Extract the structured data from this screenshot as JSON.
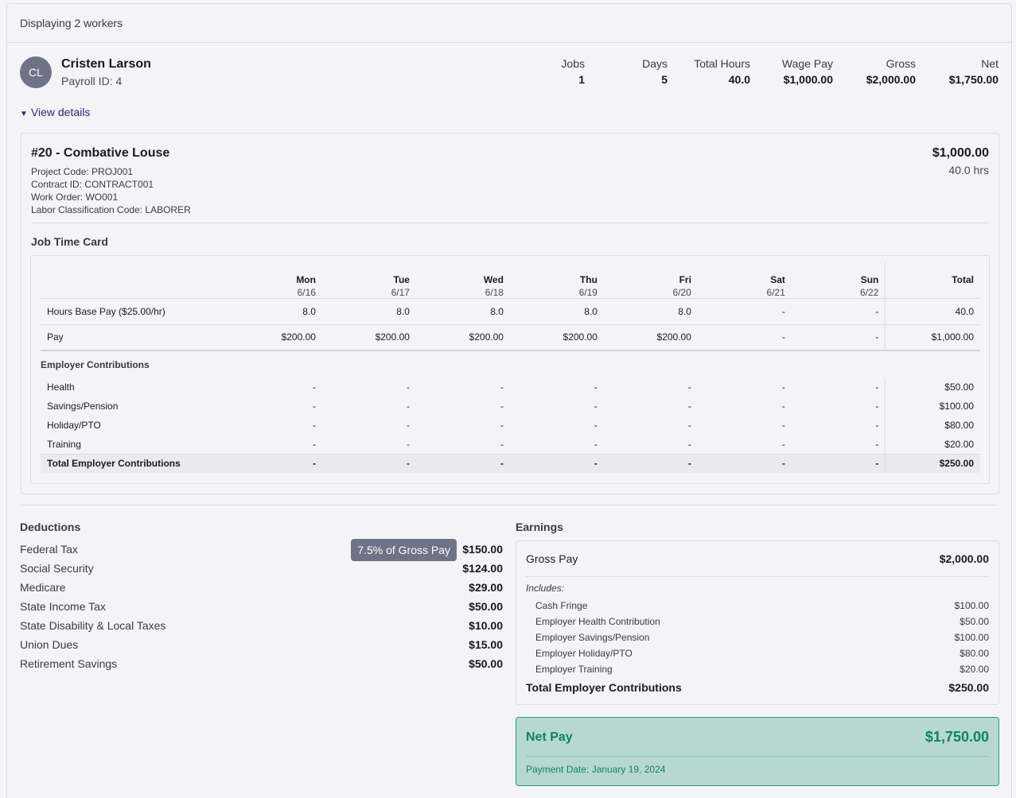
{
  "header": {
    "displaying": "Displaying 2 workers"
  },
  "worker": {
    "initials": "CL",
    "name": "Cristen Larson",
    "payroll_id": "Payroll ID: 4",
    "stats": [
      {
        "label": "Jobs",
        "value": "1"
      },
      {
        "label": "Days",
        "value": "5"
      },
      {
        "label": "Total Hours",
        "value": "40.0"
      },
      {
        "label": "Wage Pay",
        "value": "$1,000.00"
      },
      {
        "label": "Gross",
        "value": "$2,000.00"
      },
      {
        "label": "Net",
        "value": "$1,750.00"
      }
    ],
    "view_details": "View details"
  },
  "job": {
    "title": "#20 - Combative Louse",
    "meta": [
      "Project Code: PROJ001",
      "Contract ID: CONTRACT001",
      "Work Order: WO001",
      "Labor Classification Code: LABORER"
    ],
    "amount": "$1,000.00",
    "hours": "40.0 hrs",
    "time_card_label": "Job Time Card",
    "days": [
      {
        "name": "Mon",
        "date": "6/16"
      },
      {
        "name": "Tue",
        "date": "6/17"
      },
      {
        "name": "Wed",
        "date": "6/18"
      },
      {
        "name": "Thu",
        "date": "6/19"
      },
      {
        "name": "Fri",
        "date": "6/20"
      },
      {
        "name": "Sat",
        "date": "6/21"
      },
      {
        "name": "Sun",
        "date": "6/22"
      }
    ],
    "total_header": "Total",
    "rows": [
      {
        "label": "Hours Base Pay ($25.00/hr)",
        "values": [
          "8.0",
          "8.0",
          "8.0",
          "8.0",
          "8.0",
          "-",
          "-"
        ],
        "total": "40.0"
      },
      {
        "label": "Pay",
        "values": [
          "$200.00",
          "$200.00",
          "$200.00",
          "$200.00",
          "$200.00",
          "-",
          "-"
        ],
        "total": "$1,000.00"
      }
    ],
    "contrib_section": "Employer Contributions",
    "contrib_rows": [
      {
        "label": "Health",
        "values": [
          "-",
          "-",
          "-",
          "-",
          "-",
          "-",
          "-"
        ],
        "total": "$50.00"
      },
      {
        "label": "Savings/Pension",
        "values": [
          "-",
          "-",
          "-",
          "-",
          "-",
          "-",
          "-"
        ],
        "total": "$100.00"
      },
      {
        "label": "Holiday/PTO",
        "values": [
          "-",
          "-",
          "-",
          "-",
          "-",
          "-",
          "-"
        ],
        "total": "$80.00"
      },
      {
        "label": "Training",
        "values": [
          "-",
          "-",
          "-",
          "-",
          "-",
          "-",
          "-"
        ],
        "total": "$20.00"
      }
    ],
    "contrib_total": {
      "label": "Total Employer Contributions",
      "values": [
        "-",
        "-",
        "-",
        "-",
        "-",
        "-",
        "-"
      ],
      "total": "$250.00"
    }
  },
  "deductions": {
    "title": "Deductions",
    "tooltip": "7.5% of Gross Pay",
    "items": [
      {
        "label": "Federal Tax",
        "value": "$150.00"
      },
      {
        "label": "Social Security",
        "value": "$124.00"
      },
      {
        "label": "Medicare",
        "value": "$29.00"
      },
      {
        "label": "State Income Tax",
        "value": "$50.00"
      },
      {
        "label": "State Disability & Local Taxes",
        "value": "$10.00"
      },
      {
        "label": "Union Dues",
        "value": "$15.00"
      },
      {
        "label": "Retirement Savings",
        "value": "$50.00"
      }
    ]
  },
  "earnings": {
    "title": "Earnings",
    "gross_label": "Gross Pay",
    "gross_value": "$2,000.00",
    "includes_label": "Includes:",
    "includes": [
      {
        "label": "Cash Fringe",
        "value": "$100.00"
      },
      {
        "label": "Employer Health Contribution",
        "value": "$50.00"
      },
      {
        "label": "Employer Savings/Pension",
        "value": "$100.00"
      },
      {
        "label": "Employer Holiday/PTO",
        "value": "$80.00"
      },
      {
        "label": "Employer Training",
        "value": "$20.00"
      }
    ],
    "total_label": "Total Employer Contributions",
    "total_value": "$250.00"
  },
  "net_pay": {
    "label": "Net Pay",
    "value": "$1,750.00",
    "payment_date": "Payment Date: January 19, 2024"
  },
  "colors": {
    "accent_link": "#23306e",
    "avatar_bg": "#6e7387",
    "net_bg": "#b6d8d0",
    "net_text": "#11806a"
  }
}
